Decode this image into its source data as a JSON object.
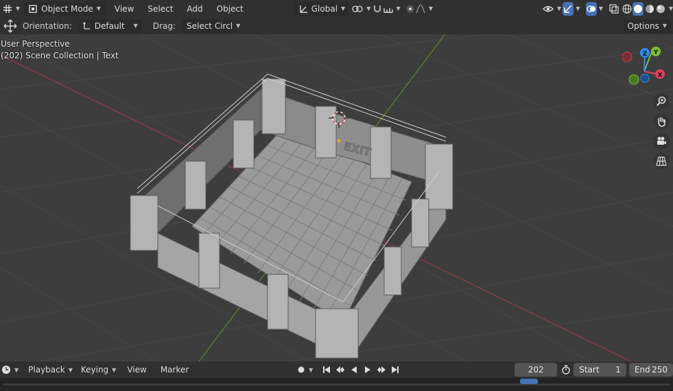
{
  "header": {
    "mode": "Object Mode",
    "menus": [
      "View",
      "Select",
      "Add",
      "Object"
    ],
    "transform_orientation": "Global"
  },
  "tool_settings": {
    "orientation_label": "Orientation:",
    "orientation_value": "Default",
    "drag_label": "Drag:",
    "drag_value": "Select Circl",
    "options_label": "Options"
  },
  "viewport": {
    "perspective": "User Perspective",
    "collection": "(202) Scene Collection | Text",
    "scene_text": "EXIT"
  },
  "gizmo": {
    "x_label": "X",
    "y_label": "Y",
    "z_label": "Z"
  },
  "timeline": {
    "menus": [
      "Playback",
      "Keying",
      "View",
      "Marker"
    ],
    "current_frame": "202",
    "start_label": "Start",
    "start_value": "1",
    "end_label": "End",
    "end_value": "250"
  },
  "colors": {
    "x_axis": "#e0405a",
    "y_axis": "#7bbf3a",
    "z_axis": "#2e8be8",
    "active_blue": "#4772b3"
  }
}
